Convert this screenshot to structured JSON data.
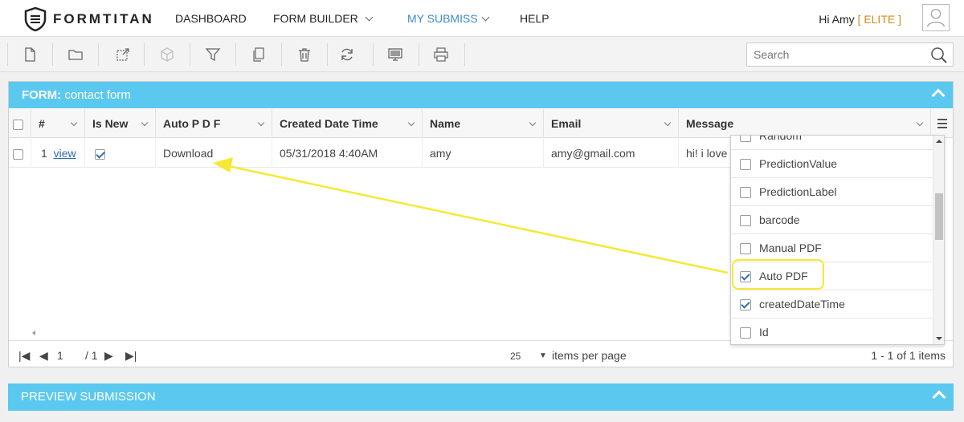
{
  "app": {
    "logo_text": "FORMTITAN"
  },
  "nav": {
    "items": [
      {
        "label": "DASHBOARD"
      },
      {
        "label": "FORM BUILDER"
      },
      {
        "label": "MY SUBMISS"
      },
      {
        "label": "HELP"
      }
    ],
    "greeting": "Hi Amy",
    "tier_open": "[",
    "tier": "ELITE",
    "tier_close": "]"
  },
  "search": {
    "placeholder": "Search"
  },
  "panel": {
    "title_prefix": "FORM:",
    "title": "contact form"
  },
  "grid": {
    "columns": [
      "#",
      "Is New",
      "Auto P D F",
      "Created Date Time",
      "Name",
      "Email",
      "Message"
    ],
    "rows": [
      {
        "num": "1",
        "link": "view",
        "is_new": true,
        "auto_pdf": "Download",
        "created": "05/31/2018 4:40AM",
        "name": "amy",
        "email": "amy@gmail.com",
        "message": "hi! i love y"
      }
    ]
  },
  "column_chooser": {
    "items": [
      {
        "label": "Random",
        "checked": false
      },
      {
        "label": "PredictionValue",
        "checked": false
      },
      {
        "label": "PredictionLabel",
        "checked": false
      },
      {
        "label": "barcode",
        "checked": false
      },
      {
        "label": "Manual PDF",
        "checked": false
      },
      {
        "label": "Auto PDF",
        "checked": true
      },
      {
        "label": "createdDateTime",
        "checked": true
      },
      {
        "label": "Id",
        "checked": false
      }
    ]
  },
  "pager": {
    "page": "1",
    "of": "/ 1",
    "page_size": "25",
    "items_per_page": "items per page",
    "summary": "1 - 1 of 1 items"
  },
  "preview": {
    "title": "PREVIEW SUBMISSION"
  },
  "colors": {
    "accent": "#5bc8ef",
    "highlight": "#f5e934",
    "elite": "#d48c1a"
  }
}
